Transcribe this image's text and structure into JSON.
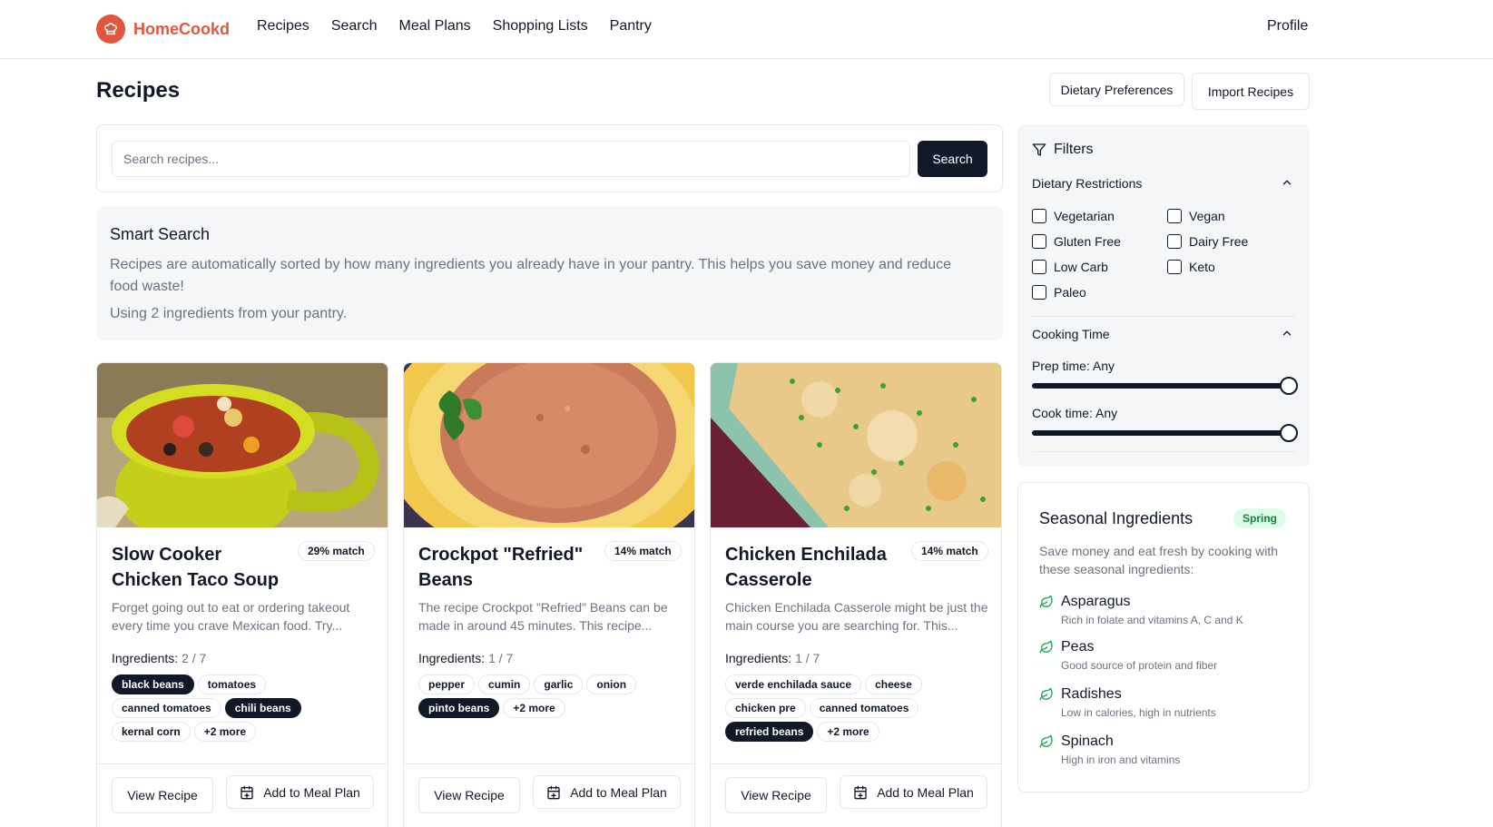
{
  "header": {
    "brand": "HomeCookd",
    "nav": [
      "Recipes",
      "Search",
      "Meal Plans",
      "Shopping Lists",
      "Pantry"
    ],
    "profile": "Profile"
  },
  "page": {
    "title": "Recipes",
    "dietary_button": "Dietary Preferences",
    "import_button": "Import Recipes"
  },
  "search": {
    "placeholder": "Search recipes...",
    "button": "Search"
  },
  "smart_search": {
    "title": "Smart Search",
    "description": "Recipes are automatically sorted by how many ingredients you already have in your pantry. This helps you save money and reduce food waste!",
    "using": "Using 2 ingredients from your pantry."
  },
  "recipes": [
    {
      "title": "Slow Cooker Chicken Taco Soup",
      "match": "29% match",
      "description": "Forget going out to eat or ordering takeout every time you crave Mexican food. Try...",
      "ingredients_label": "Ingredients:",
      "ingredients_count": "2 / 7",
      "chips": [
        {
          "label": "black beans",
          "owned": true
        },
        {
          "label": "tomatoes",
          "owned": false
        },
        {
          "label": "canned tomatoes",
          "owned": false
        },
        {
          "label": "chili beans",
          "owned": true
        },
        {
          "label": "kernal corn",
          "owned": false
        },
        {
          "label": "+2 more",
          "owned": false
        }
      ],
      "view": "View Recipe",
      "add": "Add to Meal Plan"
    },
    {
      "title": "Crockpot \"Refried\" Beans",
      "match": "14% match",
      "description": "The recipe Crockpot \"Refried\" Beans can be made in around 45 minutes. This recipe...",
      "ingredients_label": "Ingredients:",
      "ingredients_count": "1 / 7",
      "chips": [
        {
          "label": "pepper",
          "owned": false
        },
        {
          "label": "cumin",
          "owned": false
        },
        {
          "label": "garlic",
          "owned": false
        },
        {
          "label": "onion",
          "owned": false
        },
        {
          "label": "pinto beans",
          "owned": true
        },
        {
          "label": "+2 more",
          "owned": false
        }
      ],
      "view": "View Recipe",
      "add": "Add to Meal Plan"
    },
    {
      "title": "Chicken Enchilada Casserole",
      "match": "14% match",
      "description": "Chicken Enchilada Casserole might be just the main course you are searching for. This...",
      "ingredients_label": "Ingredients:",
      "ingredients_count": "1 / 7",
      "chips": [
        {
          "label": "verde enchilada sauce",
          "owned": false
        },
        {
          "label": "cheese",
          "owned": false
        },
        {
          "label": "chicken pre",
          "owned": false
        },
        {
          "label": "canned tomatoes",
          "owned": false
        },
        {
          "label": "refried beans",
          "owned": true
        },
        {
          "label": "+2 more",
          "owned": false
        }
      ],
      "view": "View Recipe",
      "add": "Add to Meal Plan"
    }
  ],
  "filters": {
    "title": "Filters",
    "dietary": {
      "title": "Dietary Restrictions",
      "options": [
        "Vegetarian",
        "Vegan",
        "Gluten Free",
        "Dairy Free",
        "Low Carb",
        "Keto",
        "Paleo"
      ]
    },
    "cooking": {
      "title": "Cooking Time",
      "prep": "Prep time: Any",
      "cook": "Cook time: Any",
      "prep_level": 1.0,
      "cook_level": 1.0
    }
  },
  "seasonal": {
    "title": "Seasonal Ingredients",
    "season": "Spring",
    "description": "Save money and eat fresh by cooking with these seasonal ingredients:",
    "items": [
      {
        "name": "Asparagus",
        "note": "Rich in folate and vitamins A, C and K"
      },
      {
        "name": "Peas",
        "note": "Good source of protein and fiber"
      },
      {
        "name": "Radishes",
        "note": "Low in calories, high in nutrients"
      },
      {
        "name": "Spinach",
        "note": "High in iron and vitamins"
      }
    ]
  },
  "colors": {
    "brand": "#e0573d",
    "primary": "#111827",
    "muted": "#6b7280",
    "season_badge_bg": "#dcfce7",
    "season_badge_fg": "#15803d",
    "leaf": "#22a35a"
  }
}
